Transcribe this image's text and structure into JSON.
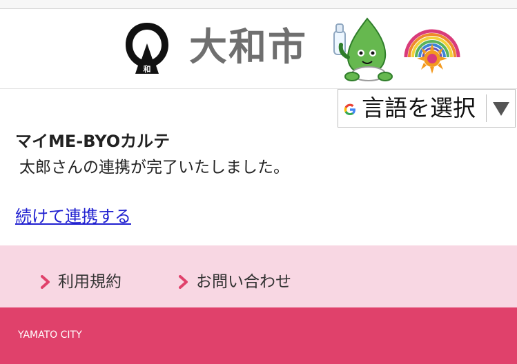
{
  "header": {
    "emblem_icon": "yamato-city-emblem-icon",
    "city_name": "大和市",
    "mascot_icon": "yamato-mascot-with-bottle-icon",
    "sun_logo_icon": "rainbow-sun-logo-icon"
  },
  "language_selector": {
    "icon": "google-g-icon",
    "label": "言語を選択",
    "arrow_icon": "triangle-down-icon"
  },
  "content": {
    "service_title": "マイME-BYOカルテ",
    "message": "太郎さんの連携が完了いたしました。",
    "continue_link": "続けて連携する"
  },
  "footer_links": [
    {
      "label": "利用規約",
      "icon": "chevron-right-icon"
    },
    {
      "label": "お問い合わせ",
      "icon": "chevron-right-icon"
    }
  ],
  "footer": {
    "city_label": "YAMATO CITY"
  },
  "colors": {
    "link": "#1f1fd0",
    "footer_links_bg": "#f8d7e3",
    "footer_bar_bg": "#e0416b",
    "chevron": "#e0416b",
    "city_name_text": "#6f6f6f"
  }
}
